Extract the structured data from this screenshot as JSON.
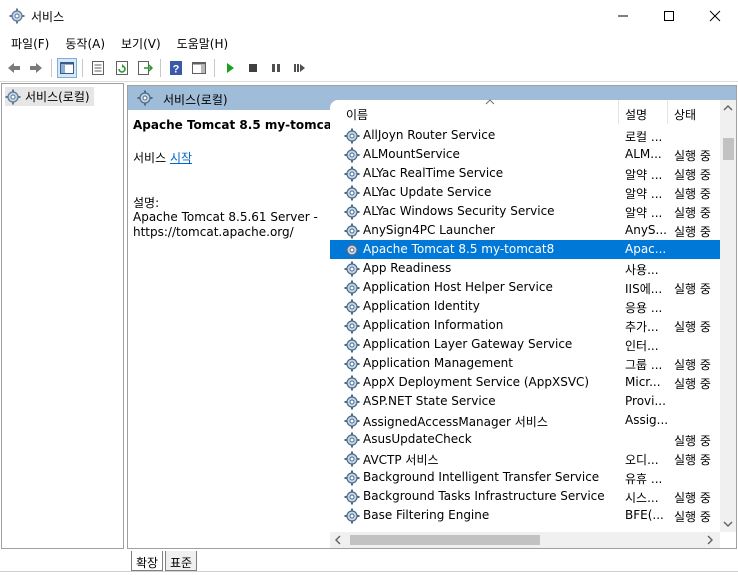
{
  "window": {
    "title": "서비스",
    "minimize_icon": "minimize-icon",
    "maximize_icon": "maximize-icon",
    "close_icon": "close-icon"
  },
  "menu": [
    "파일(F)",
    "동작(A)",
    "보기(V)",
    "도움말(H)"
  ],
  "toolbar": {
    "icons": [
      "back-arrow-icon",
      "forward-arrow-icon",
      "show-hide-console-tree-icon",
      "properties-icon",
      "refresh-icon",
      "export-list-icon",
      "help-icon",
      "show-hide-action-pane-icon",
      "start-service-icon",
      "stop-service-icon",
      "pause-service-icon",
      "resume-service-icon"
    ]
  },
  "tree": {
    "root_label": "서비스(로컬)"
  },
  "content_header": {
    "title": "서비스(로컬)"
  },
  "description_pane": {
    "service_name": "Apache Tomcat 8.5 my-tomcat8",
    "action_prefix": "서비스 ",
    "action_link": "시작",
    "description_label": "설명:",
    "description_text": "Apache Tomcat 8.5.61 Server - https://tomcat.apache.org/"
  },
  "columns": {
    "name": "이름",
    "description": "설명",
    "status": "상태"
  },
  "services": [
    {
      "name": "AllJoyn Router Service",
      "description": "로컬 ...",
      "status": ""
    },
    {
      "name": "ALMountService",
      "description": "ALM...",
      "status": "실행 중"
    },
    {
      "name": "ALYac RealTime Service",
      "description": "알약 ...",
      "status": "실행 중"
    },
    {
      "name": "ALYac Update Service",
      "description": "알약 ...",
      "status": "실행 중"
    },
    {
      "name": "ALYac Windows Security Service",
      "description": "알약 ...",
      "status": "실행 중"
    },
    {
      "name": "AnySign4PC Launcher",
      "description": "AnyS...",
      "status": "실행 중"
    },
    {
      "name": "Apache Tomcat 8.5 my-tomcat8",
      "description": "Apac...",
      "status": ""
    },
    {
      "name": "App Readiness",
      "description": "사용...",
      "status": ""
    },
    {
      "name": "Application Host Helper Service",
      "description": "IIS에...",
      "status": "실행 중"
    },
    {
      "name": "Application Identity",
      "description": "응용 ...",
      "status": ""
    },
    {
      "name": "Application Information",
      "description": "추가...",
      "status": "실행 중"
    },
    {
      "name": "Application Layer Gateway Service",
      "description": "인터...",
      "status": ""
    },
    {
      "name": "Application Management",
      "description": "그룹 ...",
      "status": "실행 중"
    },
    {
      "name": "AppX Deployment Service (AppXSVC)",
      "description": "Micr...",
      "status": "실행 중"
    },
    {
      "name": "ASP.NET State Service",
      "description": "Provi...",
      "status": ""
    },
    {
      "name": "AssignedAccessManager 서비스",
      "description": "Assig...",
      "status": ""
    },
    {
      "name": "AsusUpdateCheck",
      "description": "",
      "status": "실행 중"
    },
    {
      "name": "AVCTP 서비스",
      "description": "오디...",
      "status": "실행 중"
    },
    {
      "name": "Background Intelligent Transfer Service",
      "description": "유휴 ...",
      "status": ""
    },
    {
      "name": "Background Tasks Infrastructure Service",
      "description": "시스...",
      "status": "실행 중"
    },
    {
      "name": "Base Filtering Engine",
      "description": "BFE(...",
      "status": "실행 중"
    }
  ],
  "selected_index": 6,
  "tabs": [
    "확장",
    "표준"
  ],
  "colors": {
    "selection": "#0078d7",
    "header_band": "#9fbcd8",
    "link": "#0066cc"
  }
}
